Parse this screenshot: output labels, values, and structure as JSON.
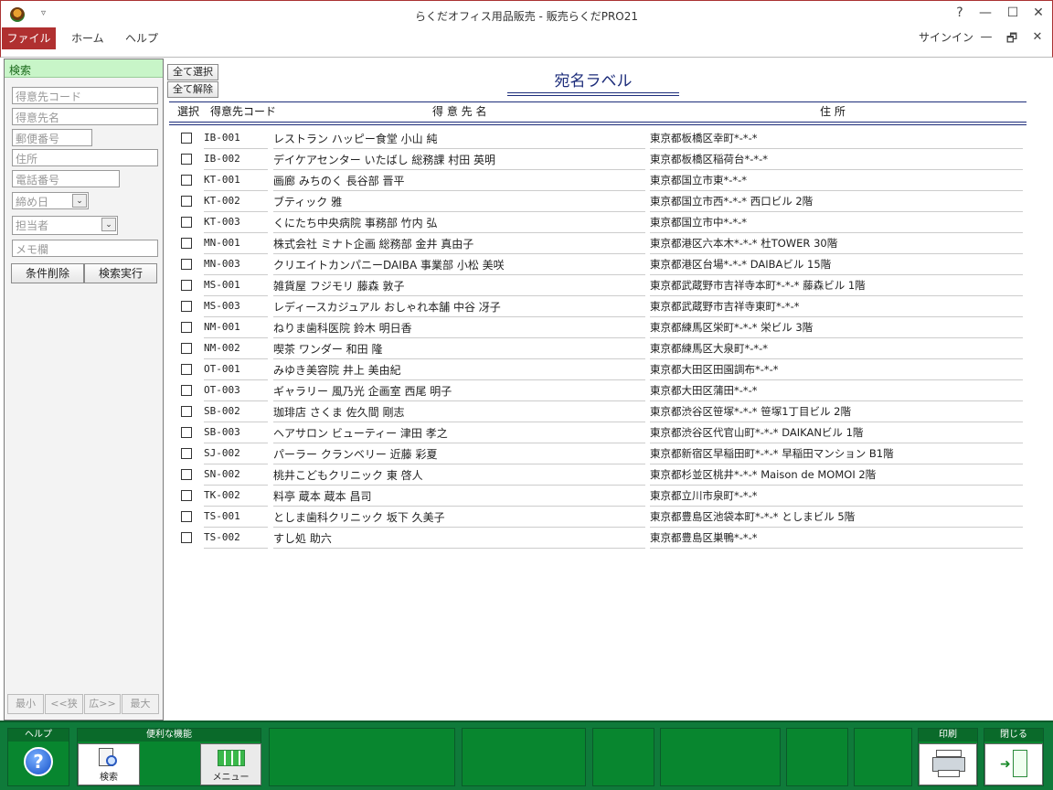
{
  "window": {
    "title": "らくだオフィス用品販売 - 販売らくだPRO21",
    "help_glyph": "?",
    "minimize_glyph": "—",
    "maximize_glyph": "☐",
    "close_glyph": "✕",
    "qat_glyph": "▿"
  },
  "menubar": {
    "tabs": [
      "ファイル",
      "ホーム",
      "ヘルプ"
    ],
    "signin": "サインイン",
    "restore_glyph": "🗗"
  },
  "search_panel": {
    "header": "検索",
    "fields": {
      "customer_code": "得意先コード",
      "customer_name": "得意先名",
      "postal_code": "郵便番号",
      "address": "住所",
      "phone": "電話番号",
      "closing_day": "締め日",
      "staff": "担当者",
      "memo": "メモ欄"
    },
    "combo_arrow": "⌄",
    "clear_button": "条件削除",
    "search_button": "検索実行",
    "pager": [
      "最小",
      "<<狭",
      "広>>",
      "最大"
    ]
  },
  "main": {
    "select_all": "全て選択",
    "deselect_all": "全て解除",
    "title": "宛名ラベル",
    "columns": {
      "select": "選択",
      "code": "得意先コード",
      "name": "得 意 先 名",
      "address": "住   所"
    },
    "rows": [
      {
        "code": "IB-001",
        "name": "レストラン ハッピー食堂 小山 純",
        "address": "東京都板橋区幸町*-*-*"
      },
      {
        "code": "IB-002",
        "name": "デイケアセンター いたばし 総務課 村田 英明",
        "address": "東京都板橋区稲荷台*-*-*"
      },
      {
        "code": "KT-001",
        "name": "画廊 みちのく 長谷部 晋平",
        "address": "東京都国立市東*-*-*"
      },
      {
        "code": "KT-002",
        "name": "ブティック 雅",
        "address": "東京都国立市西*-*-* 西口ビル 2階"
      },
      {
        "code": "KT-003",
        "name": "くにたち中央病院 事務部 竹内 弘",
        "address": "東京都国立市中*-*-*"
      },
      {
        "code": "MN-001",
        "name": "株式会社 ミナト企画 総務部 金井 真由子",
        "address": "東京都港区六本木*-*-* 杜TOWER 30階"
      },
      {
        "code": "MN-003",
        "name": "クリエイトカンパニーDAIBA 事業部 小松 美咲",
        "address": "東京都港区台場*-*-* DAIBAビル 15階"
      },
      {
        "code": "MS-001",
        "name": "雑貨屋 フジモリ 藤森 敦子",
        "address": "東京都武蔵野市吉祥寺本町*-*-* 藤森ビル 1階"
      },
      {
        "code": "MS-003",
        "name": "レディースカジュアル おしゃれ本舗 中谷 冴子",
        "address": "東京都武蔵野市吉祥寺東町*-*-*"
      },
      {
        "code": "NM-001",
        "name": "ねりま歯科医院 鈴木 明日香",
        "address": "東京都練馬区栄町*-*-* 栄ビル 3階"
      },
      {
        "code": "NM-002",
        "name": "喫茶 ワンダー 和田 隆",
        "address": "東京都練馬区大泉町*-*-*"
      },
      {
        "code": "OT-001",
        "name": "みゆき美容院 井上 美由紀",
        "address": "東京都大田区田園調布*-*-*"
      },
      {
        "code": "OT-003",
        "name": "ギャラリー 風乃光 企画室 西尾 明子",
        "address": "東京都大田区蒲田*-*-*"
      },
      {
        "code": "SB-002",
        "name": "珈琲店 さくま 佐久間 剛志",
        "address": "東京都渋谷区笹塚*-*-* 笹塚1丁目ビル 2階"
      },
      {
        "code": "SB-003",
        "name": "ヘアサロン ビューティー 津田 孝之",
        "address": "東京都渋谷区代官山町*-*-* DAIKANビル 1階"
      },
      {
        "code": "SJ-002",
        "name": "パーラー クランベリー 近藤 彩夏",
        "address": "東京都新宿区早稲田町*-*-* 早稲田マンション B1階"
      },
      {
        "code": "SN-002",
        "name": "桃井こどもクリニック 東 啓人",
        "address": "東京都杉並区桃井*-*-* Maison de MOMOI 2階"
      },
      {
        "code": "TK-002",
        "name": "料亭 蔵本 蔵本 昌司",
        "address": "東京都立川市泉町*-*-*"
      },
      {
        "code": "TS-001",
        "name": "としま歯科クリニック 坂下 久美子",
        "address": "東京都豊島区池袋本町*-*-* としまビル 5階"
      },
      {
        "code": "TS-002",
        "name": "すし処 助六",
        "address": "東京都豊島区巣鴨*-*-*"
      }
    ]
  },
  "toolbar": {
    "help_label": "ヘルプ",
    "help_glyph": "?",
    "tools_label": "便利な機能",
    "search_caption": "検索",
    "menu_caption": "メニュー",
    "print_label": "印刷",
    "close_label": "閉じる"
  }
}
